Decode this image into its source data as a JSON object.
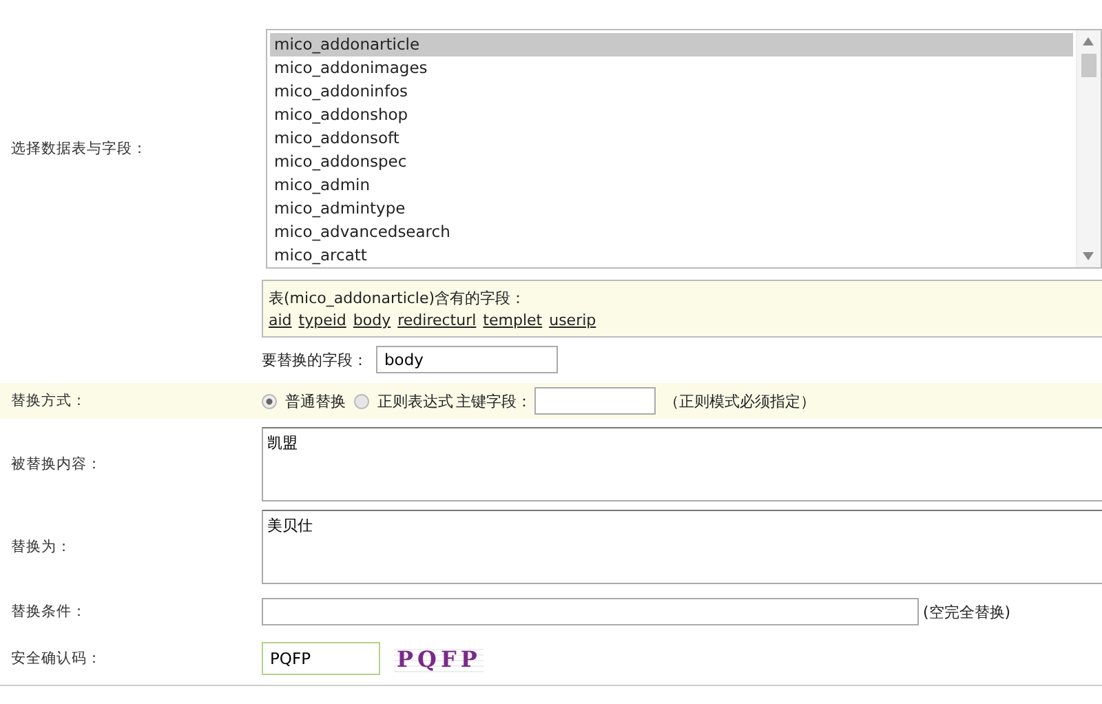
{
  "table_select": {
    "label": "选择数据表与字段：",
    "tables": [
      {
        "name": "mico_addonarticle",
        "selected": true
      },
      {
        "name": "mico_addonimages",
        "selected": false
      },
      {
        "name": "mico_addoninfos",
        "selected": false
      },
      {
        "name": "mico_addonshop",
        "selected": false
      },
      {
        "name": "mico_addonsoft",
        "selected": false
      },
      {
        "name": "mico_addonspec",
        "selected": false
      },
      {
        "name": "mico_admin",
        "selected": false
      },
      {
        "name": "mico_admintype",
        "selected": false
      },
      {
        "name": "mico_advancedsearch",
        "selected": false
      },
      {
        "name": "mico_arcatt",
        "selected": false
      }
    ]
  },
  "fields_info": {
    "title": "表(mico_addonarticle)含有的字段：",
    "fields": [
      "aid",
      "typeid",
      "body",
      "redirecturl",
      "templet",
      "userip"
    ]
  },
  "replace_field": {
    "label": "要替换的字段：",
    "value": "body"
  },
  "replace_mode": {
    "label": "替换方式：",
    "options": [
      {
        "label": "普通替换",
        "selected": true
      },
      {
        "label": "正则表达式",
        "selected": false
      }
    ],
    "key_label": "主键字段：",
    "note": "（正则模式必须指定）"
  },
  "find_content": {
    "label": "被替换内容：",
    "value": "凯盟"
  },
  "replace_with": {
    "label": "替换为：",
    "value": "美贝仕"
  },
  "condition": {
    "label": "替换条件：",
    "note": "(空完全替换)"
  },
  "captcha": {
    "label": "安全确认码：",
    "value": "PQFP",
    "image_text": "PQFP"
  }
}
